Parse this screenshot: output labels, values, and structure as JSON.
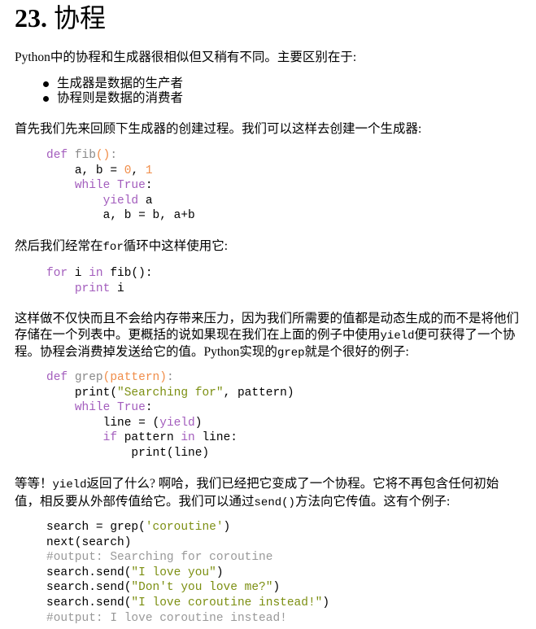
{
  "heading": {
    "number": "23.",
    "title": "协程"
  },
  "intro": "Python中的协程和生成器很相似但又稍有不同。主要区别在于:",
  "bullets": [
    "生成器是数据的生产者",
    "协程则是数据的消费者"
  ],
  "para_generator": "首先我们先来回顾下生成器的创建过程。我们可以这样去创建一个生成器:",
  "code_fib": {
    "l1_kw": "def",
    "l1_fn": "fib",
    "l1_par": "()",
    "l1_end": ":",
    "l2_a": "a, b = ",
    "l2_n0": "0",
    "l2_comma": ", ",
    "l2_n1": "1",
    "l3_kw": "while",
    "l3_true": "True",
    "l3_end": ":",
    "l4_kw": "yield",
    "l4_rest": " a",
    "l5": "a, b = b, a+b"
  },
  "para_for": {
    "pre": "然后我们经常在",
    "code": "for",
    "post": "循环中这样使用它:"
  },
  "code_for": {
    "l1_kw": "for",
    "l1_mid": " i ",
    "l1_in": "in",
    "l1_rest": " fib():",
    "l2_kw": "print",
    "l2_rest": " i"
  },
  "para_explain": {
    "t1": "这样做不仅快而且不会给内存带来压力，因为我们所需要的值都是动态生成的而不是将他们存储在一个列表中。更概括的说如果现在我们在上面的例子中使用",
    "c1": "yield",
    "t2": "便可获得了一个协程。协程会消费掉发送给它的值。Python实现的",
    "c2": "grep",
    "t3": "就是个很好的例子:"
  },
  "code_grep": {
    "l1_kw": "def",
    "l1_fn": "grep",
    "l1_par": "(pattern)",
    "l1_end": ":",
    "l2_a": "print(",
    "l2_str": "\"Searching for\"",
    "l2_b": ", pattern)",
    "l3_kw": "while",
    "l3_true": "True",
    "l3_end": ":",
    "l4_a": "line = (",
    "l4_kw": "yield",
    "l4_b": ")",
    "l5_kw": "if",
    "l5_a": " pattern ",
    "l5_in": "in",
    "l5_b": " line:",
    "l6": "print(line)"
  },
  "para_wait": {
    "t1": "等等！",
    "c1": "yield",
    "t2": "返回了什么? 啊哈，我们已经把它变成了一个协程。它将不再包含任何初始值，相反要从外部传值给它。我们可以通过",
    "c2": "send()",
    "t3": "方法向它传值。这有个例子:"
  },
  "code_send": {
    "l1_a": "search = grep(",
    "l1_str": "'coroutine'",
    "l1_b": ")",
    "l2": "next(search)",
    "l3": "#output: Searching for coroutine",
    "l4_a": "search.send(",
    "l4_str": "\"I love you\"",
    "l4_b": ")",
    "l5_a": "search.send(",
    "l5_str": "\"Don't you love me?\"",
    "l5_b": ")",
    "l6_a": "search.send(",
    "l6_str": "\"I love coroutine instead!\"",
    "l6_b": ")",
    "l7": "#output: I love coroutine instead!"
  },
  "colors": {
    "keyword": "#a35dbd",
    "function_name": "#8a8a8a",
    "number": "#f08d49",
    "string": "#7c8f12",
    "comment": "#999999"
  }
}
